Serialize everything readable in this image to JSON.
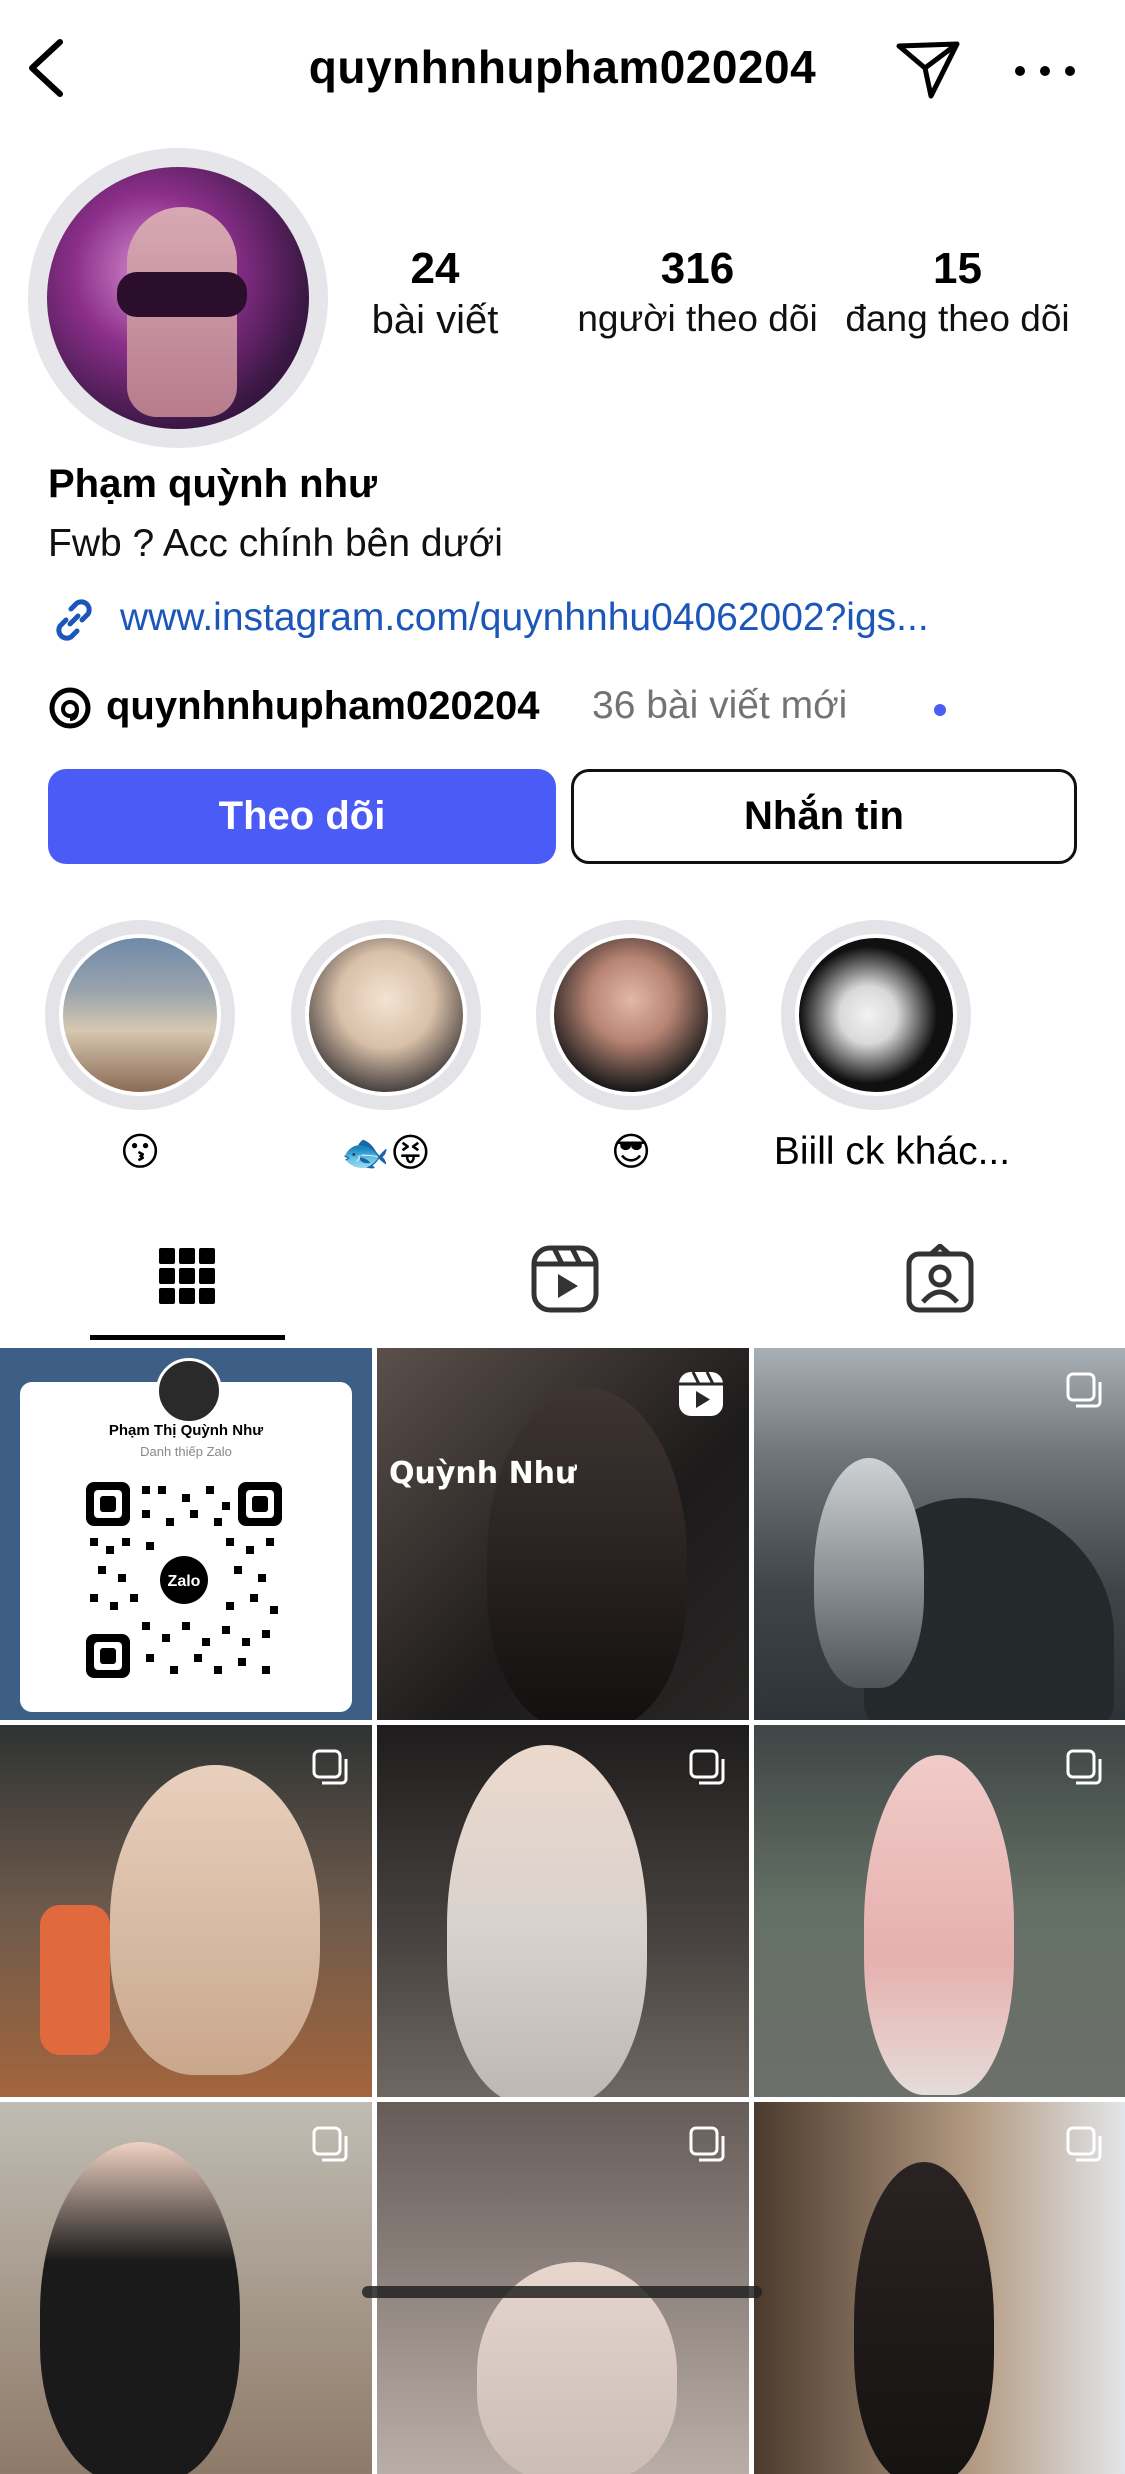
{
  "header": {
    "username": "quynhnhupham020204",
    "icons": [
      "back-icon",
      "send-icon",
      "more-icon"
    ]
  },
  "profile": {
    "posts_count": "24",
    "posts_label": "bài viết",
    "followers_count": "316",
    "followers_label": "người theo dõi",
    "following_count": "15",
    "following_label": "đang theo dõi",
    "name": "Phạm quỳnh như",
    "bio": "Fwb ? Acc chính bên dưới",
    "link": "www.instagram.com/quynhnhu04062002?igs...",
    "threads_username": "quynhnhupham020204",
    "threads_new": "36 bài viết mới"
  },
  "buttons": {
    "follow": "Theo dõi",
    "message": "Nhắn tin"
  },
  "highlights": [
    {
      "caption": "😗"
    },
    {
      "caption": "🐟😝"
    },
    {
      "caption": "😎"
    },
    {
      "caption": "Biill ck khác..."
    }
  ],
  "tabs": [
    "grid-icon",
    "reels-icon",
    "tagged-icon"
  ],
  "grid": {
    "qr_name": "Phạm Thị Quỳnh Như",
    "qr_sub": "Danh thiếp Zalo",
    "qr_logo": "Zalo",
    "reel_caption": "Quỳnh Như"
  },
  "colors": {
    "accent": "#4b5cf6",
    "link": "#1b56b8",
    "muted": "#737373"
  }
}
